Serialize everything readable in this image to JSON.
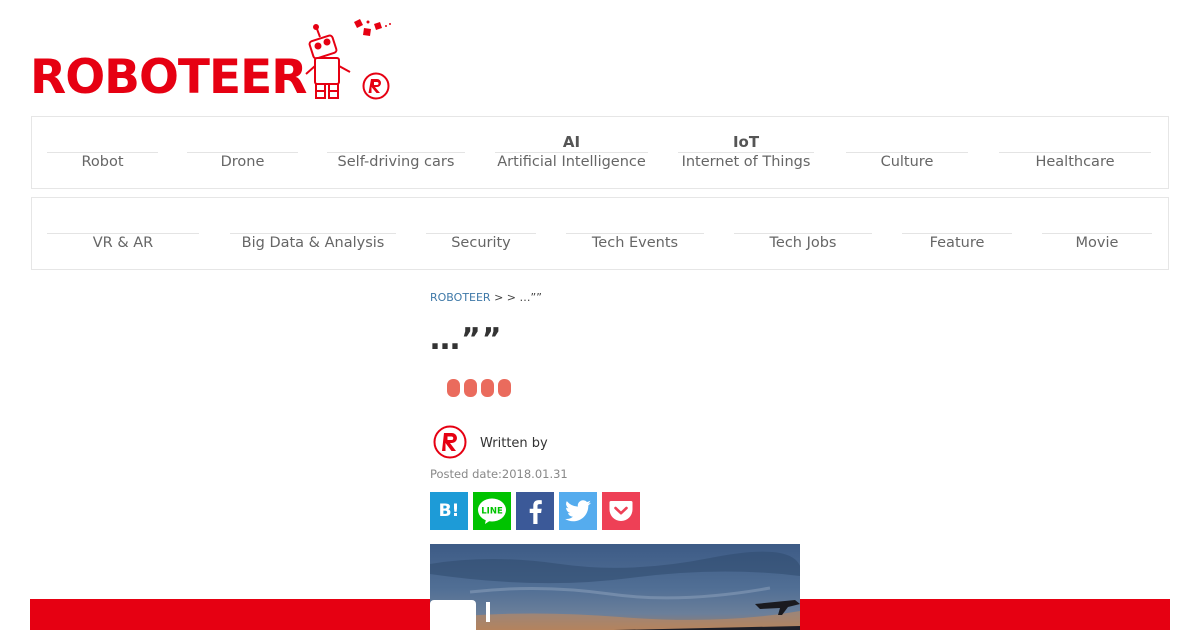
{
  "logo": {
    "text": "ROBOTEER",
    "color": "#e60012"
  },
  "nav": {
    "row1": [
      {
        "sup": "",
        "label": "Robot"
      },
      {
        "sup": "",
        "label": "Drone"
      },
      {
        "sup": "",
        "label": "Self-driving cars"
      },
      {
        "sup": "AI",
        "label": "Artificial Intelligence"
      },
      {
        "sup": "IoT",
        "label": "Internet of Things"
      },
      {
        "sup": "",
        "label": "Culture"
      },
      {
        "sup": "",
        "label": "Healthcare"
      }
    ],
    "row2": [
      {
        "label": "VR & AR"
      },
      {
        "label": "Big Data & Analysis"
      },
      {
        "label": "Security"
      },
      {
        "label": "Tech Events"
      },
      {
        "label": "Tech Jobs"
      },
      {
        "label": "Feature"
      },
      {
        "label": "Movie"
      }
    ]
  },
  "breadcrumb": {
    "home": "ROBOTEER",
    "sep1": " > ",
    "sep2": " > …””"
  },
  "article": {
    "title": "…””",
    "written_by": "Written by",
    "posted": "Posted date:2018.01.31"
  },
  "share": {
    "hatena": "B!",
    "line": "LINE"
  },
  "colors": {
    "brand_red": "#e60012",
    "pill": "#ea6b5d",
    "link": "#3f79a8",
    "hatena": "#1d9bd7",
    "line": "#00c300",
    "facebook": "#3b5998",
    "twitter": "#55acee",
    "pocket": "#ee4056"
  }
}
